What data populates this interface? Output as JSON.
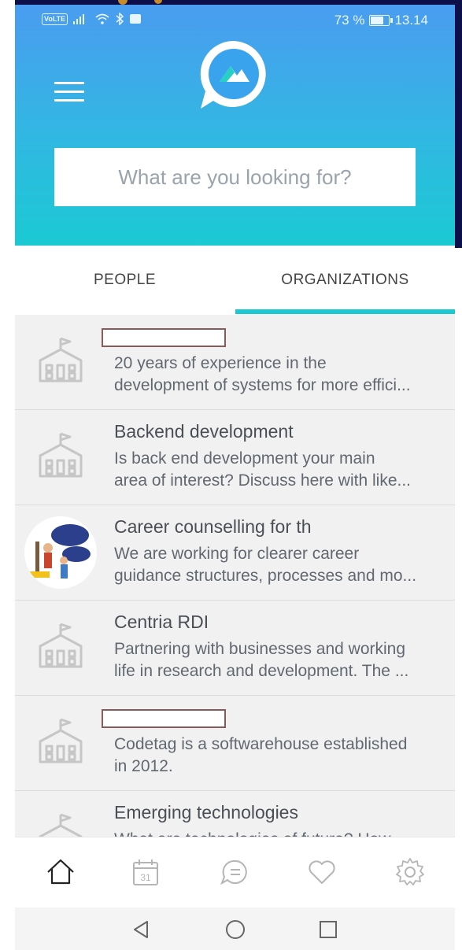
{
  "status_bar": {
    "volte": "VoLTE",
    "battery_percent": "73 %",
    "battery_level": 0.73,
    "time": "13.14"
  },
  "header": {
    "menu_icon": "menu-icon",
    "logo_icon": "chat-logo-icon",
    "accent_colors": [
      "#4a9cf0",
      "#1bc9d3"
    ]
  },
  "search": {
    "placeholder": "What are you looking for?"
  },
  "tabs": [
    {
      "label": "PEOPLE",
      "active": false
    },
    {
      "label": "ORGANIZATIONS",
      "active": true
    }
  ],
  "organizations": [
    {
      "title": "",
      "redacted": true,
      "icon": "building-icon",
      "desc_line1": "20 years of experience in the",
      "desc_line2": "development of systems for more effici..."
    },
    {
      "title": "Backend  development",
      "redacted": false,
      "icon": "building-icon",
      "desc_line1": "Is back end development your main",
      "desc_line2": "area of interest? Discuss here with like..."
    },
    {
      "title": "Career counselling for th",
      "redacted": false,
      "icon": "org-avatar-image",
      "desc_line1": "We are working for clearer career",
      "desc_line2": "guidance structures, processes and mo..."
    },
    {
      "title": "Centria RDI",
      "redacted": false,
      "icon": "building-icon",
      "desc_line1": "Partnering with businesses and working",
      "desc_line2": "life in research and development. The ..."
    },
    {
      "title": "",
      "redacted": true,
      "icon": "building-icon",
      "desc_line1": "Codetag is a softwarehouse established",
      "desc_line2": "in 2012."
    },
    {
      "title": "Emerging technologies",
      "redacted": false,
      "icon": "building-icon",
      "desc_line1": "What are technologies of future? How",
      "desc_line2": ""
    }
  ],
  "bottom_nav": [
    "home-icon",
    "calendar-icon",
    "chat-icon",
    "heart-icon",
    "settings-icon"
  ],
  "calendar_day": "31",
  "system_nav": [
    "back-icon",
    "home-circle-icon",
    "recents-icon"
  ]
}
